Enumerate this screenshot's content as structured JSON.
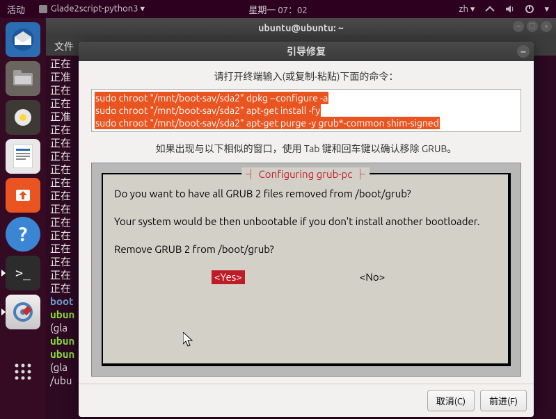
{
  "top_panel": {
    "activities": "活动",
    "app_name": "Glade2script-python3",
    "datetime": "星期一 07：02",
    "input_source": "zh"
  },
  "terminal": {
    "title": "ubuntu@ubuntu: ~",
    "menu_file": "文件",
    "lines": [
      "正在",
      "正准",
      "正在",
      "正在",
      "正准",
      "正在",
      "正在",
      "正在",
      "正在",
      "正在",
      "正在",
      "正在",
      "正在",
      "正在",
      "正在",
      "正在",
      "正在",
      "正在",
      "boot",
      "ubun",
      "",
      "(gla",
      "ubun",
      "ubun",
      "",
      "(gla",
      "/ubu"
    ]
  },
  "dialog": {
    "title": "引导修复",
    "instruction": "请打开终端输入(或复制-粘贴)下面的命令：",
    "commands": [
      "sudo chroot \"/mnt/boot-sav/sda2\" dpkg --configure -a",
      "sudo chroot \"/mnt/boot-sav/sda2\" apt-get install -fy",
      "sudo chroot \"/mnt/boot-sav/sda2\" apt-get purge -y grub*-common shim-signed"
    ],
    "tab_note": "如果出现与以下相似的窗口，使用 Tab 键和回车键以确认移除 GRUB。",
    "ncurses": {
      "title": "Configuring grub-pc",
      "line1": "Do you want to have all GRUB 2 files removed from /boot/grub?",
      "line2": "Your system would be then unbootable if you don't install another bootloader.",
      "line3": "Remove GRUB 2 from /boot/grub?",
      "yes": "<Yes>",
      "no": "<No>"
    },
    "cancel": "取消(C)",
    "forward": "前进(F)"
  }
}
